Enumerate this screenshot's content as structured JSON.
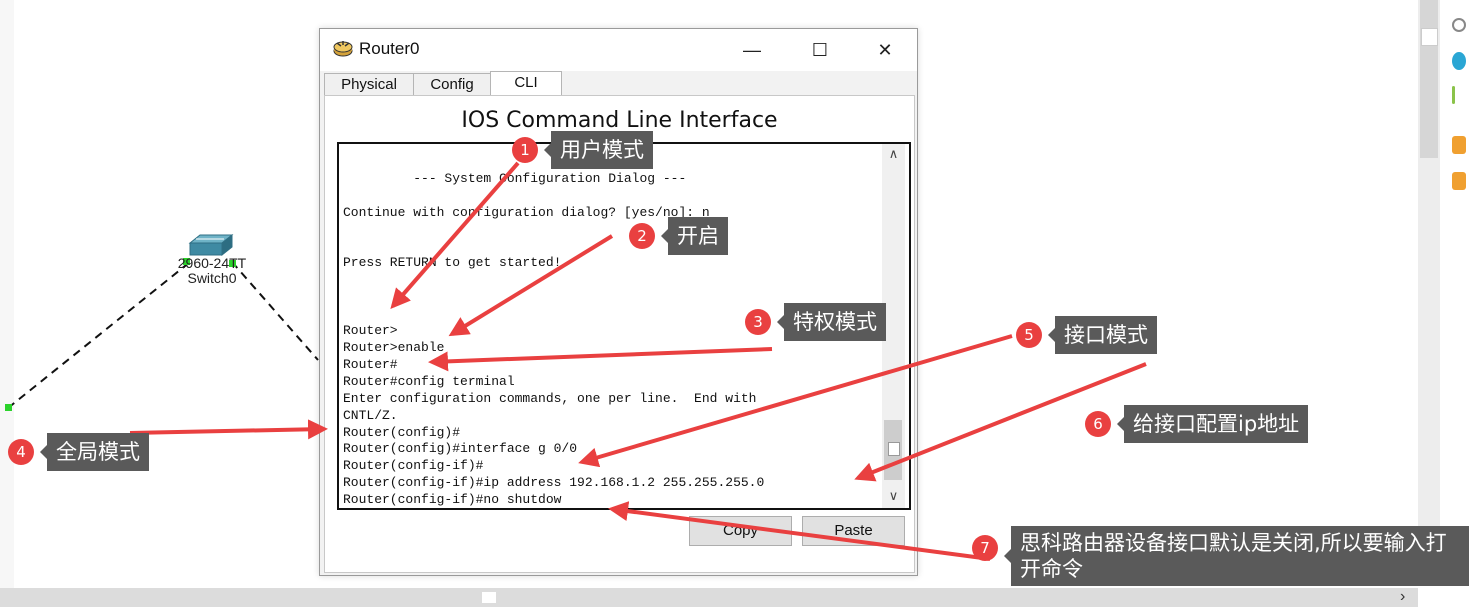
{
  "window": {
    "title": "Router0",
    "minimize": "—",
    "maximize": "☐",
    "close": "✕",
    "tabs": [
      {
        "label": "Physical"
      },
      {
        "label": "Config"
      },
      {
        "label": "CLI",
        "active": true
      }
    ],
    "cli_heading": "IOS Command Line Interface",
    "buttons": {
      "copy": "Copy",
      "paste": "Paste"
    }
  },
  "terminal": {
    "lines": [
      "",
      "         --- System Configuration Dialog ---",
      "",
      "Continue with configuration dialog? [yes/no]: n",
      "",
      "",
      "Press RETURN to get started!",
      "",
      "",
      "",
      "Router>",
      "Router>enable",
      "Router#",
      "Router#config terminal",
      "Enter configuration commands, one per line.  End with",
      "CNTL/Z.",
      "Router(config)#",
      "Router(config)#interface g 0/0",
      "Router(config-if)#",
      "Router(config-if)#ip address 192.168.1.2 255.255.255.0",
      "Router(config-if)#no shutdow"
    ]
  },
  "topology": {
    "switch_model": "2960-24TT",
    "switch_name": "Switch0"
  },
  "annotations": [
    {
      "num": "1",
      "text": "用户模式"
    },
    {
      "num": "2",
      "text": "开启"
    },
    {
      "num": "3",
      "text": "特权模式"
    },
    {
      "num": "4",
      "text": "全局模式"
    },
    {
      "num": "5",
      "text": "接口模式"
    },
    {
      "num": "6",
      "text": "给接口配置ip地址"
    },
    {
      "num": "7",
      "text": "思科路由器设备接口默认是关闭,所以要输入打开命令"
    }
  ],
  "colors": {
    "annotation_red": "#e94040",
    "annotation_box": "#5a5a5a",
    "link_green": "#2bd32b"
  },
  "icons": [
    "router-icon",
    "switch-icon",
    "scroll-up-icon",
    "scroll-down-icon"
  ]
}
